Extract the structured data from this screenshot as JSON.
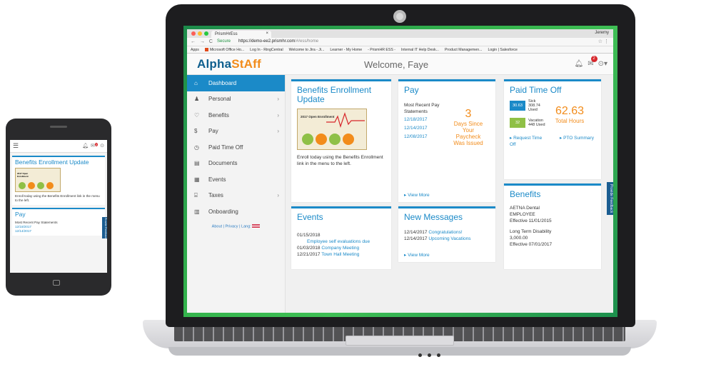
{
  "browser": {
    "tab_title": "PrismHrEss",
    "tab_close": "×",
    "user": "Jeremy",
    "secure_label": "Secure",
    "url_host": "https://demo-ee2.prismhr.com",
    "url_path": "/#/ess/home",
    "bookmarks": [
      "Apps",
      "Microsoft Office Ho...",
      "Log In - RingCentral",
      "Welcome to Jira - Ji...",
      "Learner - My Home",
      "- PrismHR ESS -",
      "Internal IT Help Desk...",
      "Product Managemen...",
      "Login | Salesforce"
    ]
  },
  "header": {
    "logo_part1": "Alpha",
    "logo_part2": "StAff",
    "welcome": "Welcome, Faye",
    "mail_badge": "2"
  },
  "sidebar": {
    "items": [
      {
        "label": "Dashboard",
        "icon": "home-icon"
      },
      {
        "label": "Personal",
        "icon": "person-icon"
      },
      {
        "label": "Benefits",
        "icon": "heart-icon"
      },
      {
        "label": "Pay",
        "icon": "dollar-icon"
      },
      {
        "label": "Paid Time Off",
        "icon": "clock-icon"
      },
      {
        "label": "Documents",
        "icon": "document-icon"
      },
      {
        "label": "Events",
        "icon": "calendar-icon"
      },
      {
        "label": "Taxes",
        "icon": "bank-icon"
      },
      {
        "label": "Onboarding",
        "icon": "onboarding-icon"
      }
    ],
    "footer": "About | Privacy | Lang:"
  },
  "enrollment": {
    "title": "Benefits Enrollment Update",
    "image_caption": "2017 Open Enrollment",
    "text": "Enroll today using the Benefits Enrollment link in the menu to the left."
  },
  "pay": {
    "title": "Pay",
    "subtitle": "Most Recent Pay Statements",
    "statements": [
      "12/18/2017",
      "12/14/2017",
      "12/08/2017"
    ],
    "days_number": "3",
    "days_text": "Days Since Your Paycheck Was Issued",
    "view_more": "View More"
  },
  "pto": {
    "title": "Paid Time Off",
    "sick_box": "30.63",
    "sick_label": "Sick 308.74 Used",
    "vacation_box": "32",
    "vacation_label": "Vacation 448 Used",
    "total_value": "62.63",
    "total_label": "Total Hours",
    "request_link": "Request Time Off",
    "summary_link": "PTO Summary",
    "feedback": "Provide Feedback"
  },
  "events": {
    "title": "Events",
    "items": [
      {
        "date": "01/15/2018",
        "name": "Employee self evaluations due"
      },
      {
        "date": "01/03/2018",
        "name": "Company Meeting"
      },
      {
        "date": "12/21/2017",
        "name": "Town Hall Meeting"
      }
    ]
  },
  "messages": {
    "title": "New Messages",
    "items": [
      {
        "date": "12/14/2017",
        "subject": "Congratulations!"
      },
      {
        "date": "12/14/2017",
        "subject": "Upcoming Vacations"
      }
    ],
    "view_more": "View More"
  },
  "benefits": {
    "title": "Benefits",
    "plans": [
      {
        "name": "AETNA Dental",
        "detail": "EMPLOYEE",
        "effective": "Effective 11/01/2015"
      },
      {
        "name": "Long Term Disability",
        "detail": "3,000.00",
        "effective": "Effective 07/01/2017"
      }
    ]
  },
  "phone": {
    "menu_icon": "☰",
    "mail_badge": "2",
    "enroll_title": "Benefits Enrollment Update",
    "enroll_caption": "2017 Open Enrollment",
    "enroll_text": "Enroll today using the Benefits Enrollment link in the menu to the left.",
    "pay_title": "Pay",
    "pay_subtitle": "Most Recent Pay Statements",
    "pay_dates": [
      "12/18/2017",
      "12/14/2017"
    ],
    "feedback": "Provide Feedback"
  },
  "colors": {
    "accent": "#1b8ac8",
    "orange": "#f28c1b",
    "screen_bg": "#3fbf55"
  }
}
